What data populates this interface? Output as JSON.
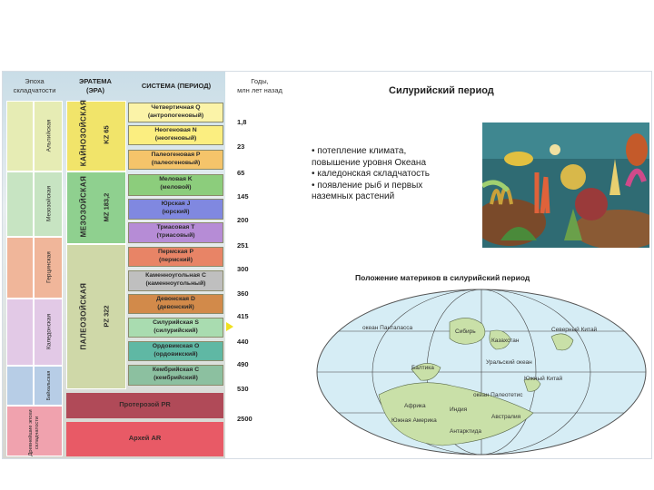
{
  "headers": {
    "fold_epoch": [
      "Эпоха",
      "складчатости"
    ],
    "eratema": [
      "ЭРАТЕМА",
      "(ЭРА)"
    ],
    "system": "СИСТЕМА (ПЕРИОД)",
    "years": [
      "Годы,",
      "млн лет назад"
    ]
  },
  "folds": [
    {
      "label": "Альпийская",
      "color": "#e6ecb4"
    },
    {
      "label": "Мезозойская",
      "color": "#c7e4c2"
    },
    {
      "label": "Герцинская",
      "color": "#f0b69a"
    },
    {
      "label": "Каледонская",
      "color": "#e2c9e6"
    },
    {
      "label": "Байкальская",
      "color": "#b7cde6"
    },
    {
      "label": "Древнейшие эпохи складчатости",
      "color": "#f0a2ae"
    }
  ],
  "eras": [
    {
      "name": "КАЙНОЗОЙСКАЯ",
      "code": "KZ 65",
      "color": "#f1e46a"
    },
    {
      "name": "МЕЗОЗОЙСКАЯ",
      "code": "MZ 183,2",
      "color": "#8fd08f"
    },
    {
      "name": "ПАЛЕОЗОЙСКАЯ",
      "code": "PZ 322",
      "color": "#cfd8a8"
    }
  ],
  "periods": [
    {
      "name": "Четвертичная Q",
      "sub": "(антропогеновый)",
      "color": "#fbf3a8"
    },
    {
      "name": "Неогеновая N",
      "sub": "(неогеновый)",
      "color": "#fbee80"
    },
    {
      "name": "Палеогеновая P",
      "sub": "(палеогеновый)",
      "color": "#f5c46a"
    },
    {
      "name": "Меловая K",
      "sub": "(меловой)",
      "color": "#8ccd7c"
    },
    {
      "name": "Юрская J",
      "sub": "(юрский)",
      "color": "#8088e0"
    },
    {
      "name": "Триасовая T",
      "sub": "(триасовый)",
      "color": "#b68cd6"
    },
    {
      "name": "Пермская P",
      "sub": "(пермский)",
      "color": "#e88466"
    },
    {
      "name": "Каменноугольная C",
      "sub": "(каменноугольный)",
      "color": "#bfbfbf"
    },
    {
      "name": "Девонская D",
      "sub": "(девонский)",
      "color": "#d28a4a"
    },
    {
      "name": "Силурийская S",
      "sub": "(силурийский)",
      "color": "#a9dcb0"
    },
    {
      "name": "Ордовикская O",
      "sub": "(ордовикский)",
      "color": "#5fb8a4"
    },
    {
      "name": "Кембрийская C",
      "sub": "(кембрийский)",
      "color": "#8cc0a0"
    }
  ],
  "proterozoic": {
    "label": "Протерозой PR",
    "color": "#b04a58"
  },
  "archean": {
    "label": "Архей AR",
    "color": "#e85a66"
  },
  "years": [
    "1,8",
    "23",
    "65",
    "145",
    "200",
    "251",
    "300",
    "360",
    "415",
    "440",
    "490",
    "530",
    "2500"
  ],
  "right": {
    "title": "Силурийский период",
    "bullets": [
      "• потепление климата,",
      "повышение уровня Океана",
      "• каледонская складчатость",
      "• появление рыб и первых",
      "наземных растений"
    ],
    "map_title": "Положение материков в силурийский период",
    "map_labels": [
      "океан Панталасса",
      "Сибирь",
      "Казахстан",
      "Северный Китай",
      "Южный Китай",
      "Балтика",
      "Уральский океан",
      "океан Палеотетис",
      "Африка",
      "Южная Америка",
      "Антарктида",
      "Австралия",
      "Индия"
    ]
  }
}
